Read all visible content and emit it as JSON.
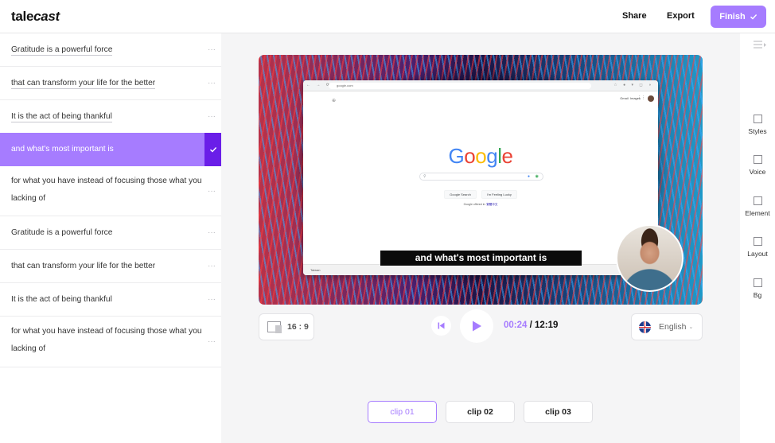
{
  "header": {
    "logo_plain": "tale",
    "logo_bold": "cast",
    "share_label": "Share",
    "export_label": "Export",
    "finish_label": "Finish"
  },
  "transcript": [
    {
      "text": "Gratitude is a powerful force",
      "active": false
    },
    {
      "text": "that can transform your life for the better",
      "active": false
    },
    {
      "text": "It is the act of being thankful",
      "active": false
    },
    {
      "text": "and what's most important is",
      "active": true
    },
    {
      "text": "for what you have instead of focusing those what you lacking of",
      "active": false
    },
    {
      "text": "Gratitude is a powerful force",
      "active": false
    },
    {
      "text": "that can transform your life for the better",
      "active": false
    },
    {
      "text": "It is the act of being thankful",
      "active": false
    },
    {
      "text": "for what you have instead of focusing those what you lacking of",
      "active": false
    }
  ],
  "transcript_more": "···",
  "preview": {
    "url": "google.com",
    "gmail_link": "Gmail",
    "images_link": "Images",
    "google_logo": [
      "G",
      "o",
      "o",
      "g",
      "l",
      "e"
    ],
    "google_logo_colors": [
      "#4285f4",
      "#ea4335",
      "#fbbc05",
      "#4285f4",
      "#34a853",
      "#ea4335"
    ],
    "search_button": "Google Search",
    "lucky_button": "I'm Feeling Lucky",
    "offered_in": "Google offered in:",
    "offered_lang": "繁體中文",
    "footer_text": "Taiwan",
    "subtitle": "and what's most important is"
  },
  "controls": {
    "aspect_ratio": "16 : 9",
    "current_time": "00:24",
    "separator": " / ",
    "total_time": "12:19",
    "language": "English"
  },
  "clips": [
    {
      "label": "clip 01",
      "active": true
    },
    {
      "label": "clip 02",
      "active": false
    },
    {
      "label": "clip 03",
      "active": false
    }
  ],
  "rail": {
    "tools": [
      "Styles",
      "Voice",
      "Element",
      "Layout",
      "Bg"
    ]
  },
  "colors": {
    "accent": "#a67cff",
    "accent_dark": "#6a1ee8"
  }
}
